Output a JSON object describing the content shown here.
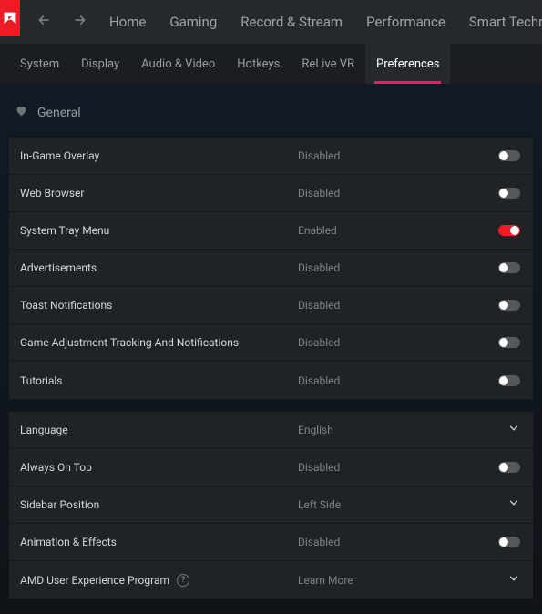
{
  "colors": {
    "accent": "#ed1c24",
    "underline": "#ed1c64"
  },
  "main_nav": [
    "Home",
    "Gaming",
    "Record & Stream",
    "Performance",
    "Smart Technology"
  ],
  "sub_nav": {
    "items": [
      "System",
      "Display",
      "Audio & Video",
      "Hotkeys",
      "ReLive VR",
      "Preferences"
    ],
    "active": "Preferences"
  },
  "section_title": "General",
  "groups": [
    {
      "rows": [
        {
          "label": "In-Game Overlay",
          "value": "Disabled",
          "control": "toggle",
          "on": false
        },
        {
          "label": "Web Browser",
          "value": "Disabled",
          "control": "toggle",
          "on": false
        },
        {
          "label": "System Tray Menu",
          "value": "Enabled",
          "control": "toggle",
          "on": true
        },
        {
          "label": "Advertisements",
          "value": "Disabled",
          "control": "toggle",
          "on": false
        },
        {
          "label": "Toast Notifications",
          "value": "Disabled",
          "control": "toggle",
          "on": false
        },
        {
          "label": "Game Adjustment Tracking And Notifications",
          "value": "Disabled",
          "control": "toggle",
          "on": false
        },
        {
          "label": "Tutorials",
          "value": "Disabled",
          "control": "toggle",
          "on": false
        }
      ]
    },
    {
      "rows": [
        {
          "label": "Language",
          "value": "English",
          "control": "chevron"
        },
        {
          "label": "Always On Top",
          "value": "Disabled",
          "control": "toggle",
          "on": false
        },
        {
          "label": "Sidebar Position",
          "value": "Left Side",
          "control": "chevron"
        },
        {
          "label": "Animation & Effects",
          "value": "Disabled",
          "control": "toggle",
          "on": false
        },
        {
          "label": "AMD User Experience Program",
          "value": "Learn More",
          "control": "chevron",
          "help": true
        }
      ]
    }
  ]
}
